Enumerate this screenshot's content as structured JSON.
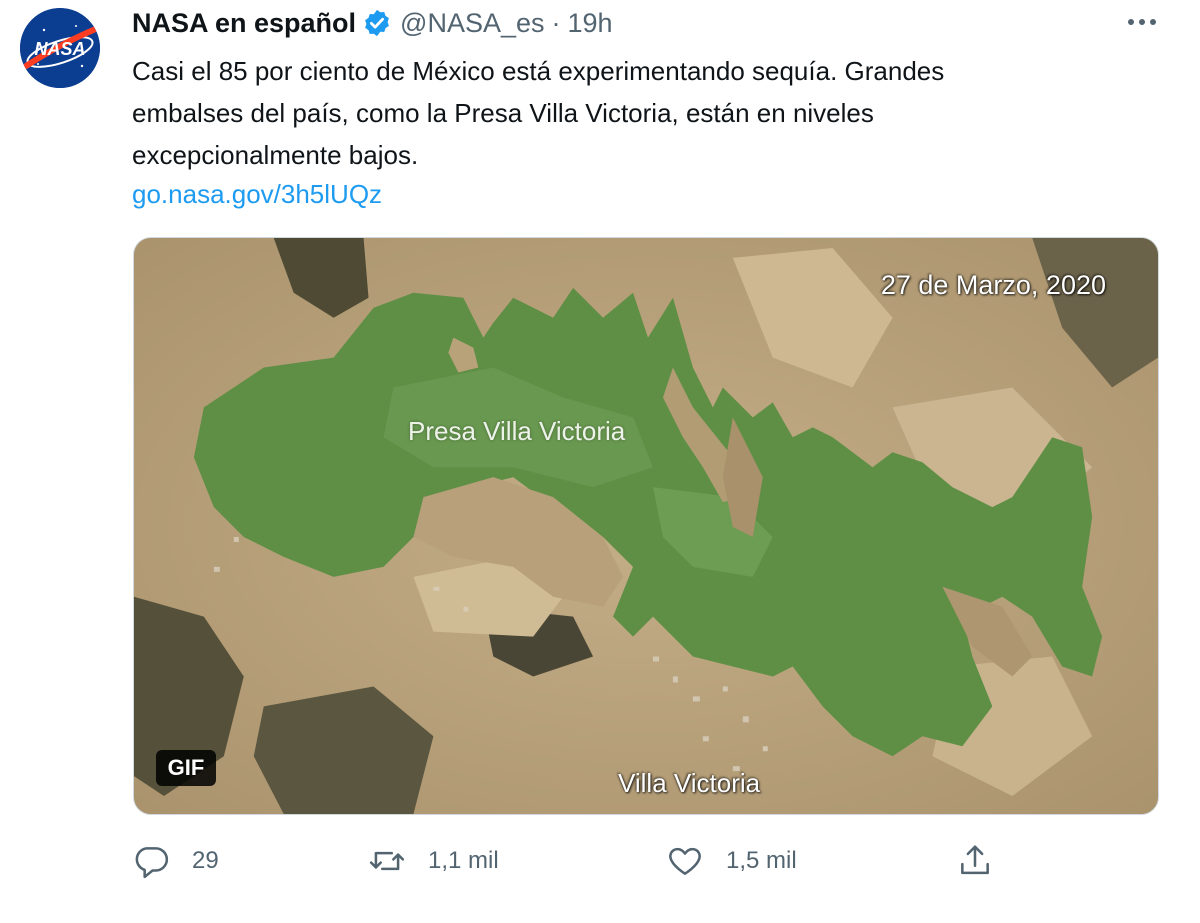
{
  "tweet": {
    "author_name": "NASA en español",
    "handle": "@NASA_es",
    "separator": "·",
    "time": "19h",
    "text_lines": [
      "Casi el 85 por ciento de México está experimentando sequía. Grandes",
      "embalses del país, como la Presa Villa Victoria, están en niveles",
      "excepcionalmente bajos."
    ],
    "link": "go.nasa.gov/3h5lUQz",
    "avatar_text": "NASA",
    "media": {
      "date_label": "27 de Marzo, 2020",
      "lake_label": "Presa Villa Victoria",
      "town_label": "Villa Victoria",
      "badge": "GIF"
    },
    "actions": {
      "reply_count": "29",
      "retweet_count": "1,1 mil",
      "like_count": "1,5 mil"
    }
  },
  "colors": {
    "link": "#1d9bf0",
    "muted": "#536471",
    "verified": "#1d9bf0",
    "nasa_blue": "#0b3d91",
    "nasa_red": "#fc3d21",
    "water": "#5f8f45",
    "land": "#b9a480"
  },
  "icons": [
    "verified-badge-icon",
    "more-options-icon",
    "reply-icon",
    "retweet-icon",
    "like-icon",
    "share-icon"
  ]
}
